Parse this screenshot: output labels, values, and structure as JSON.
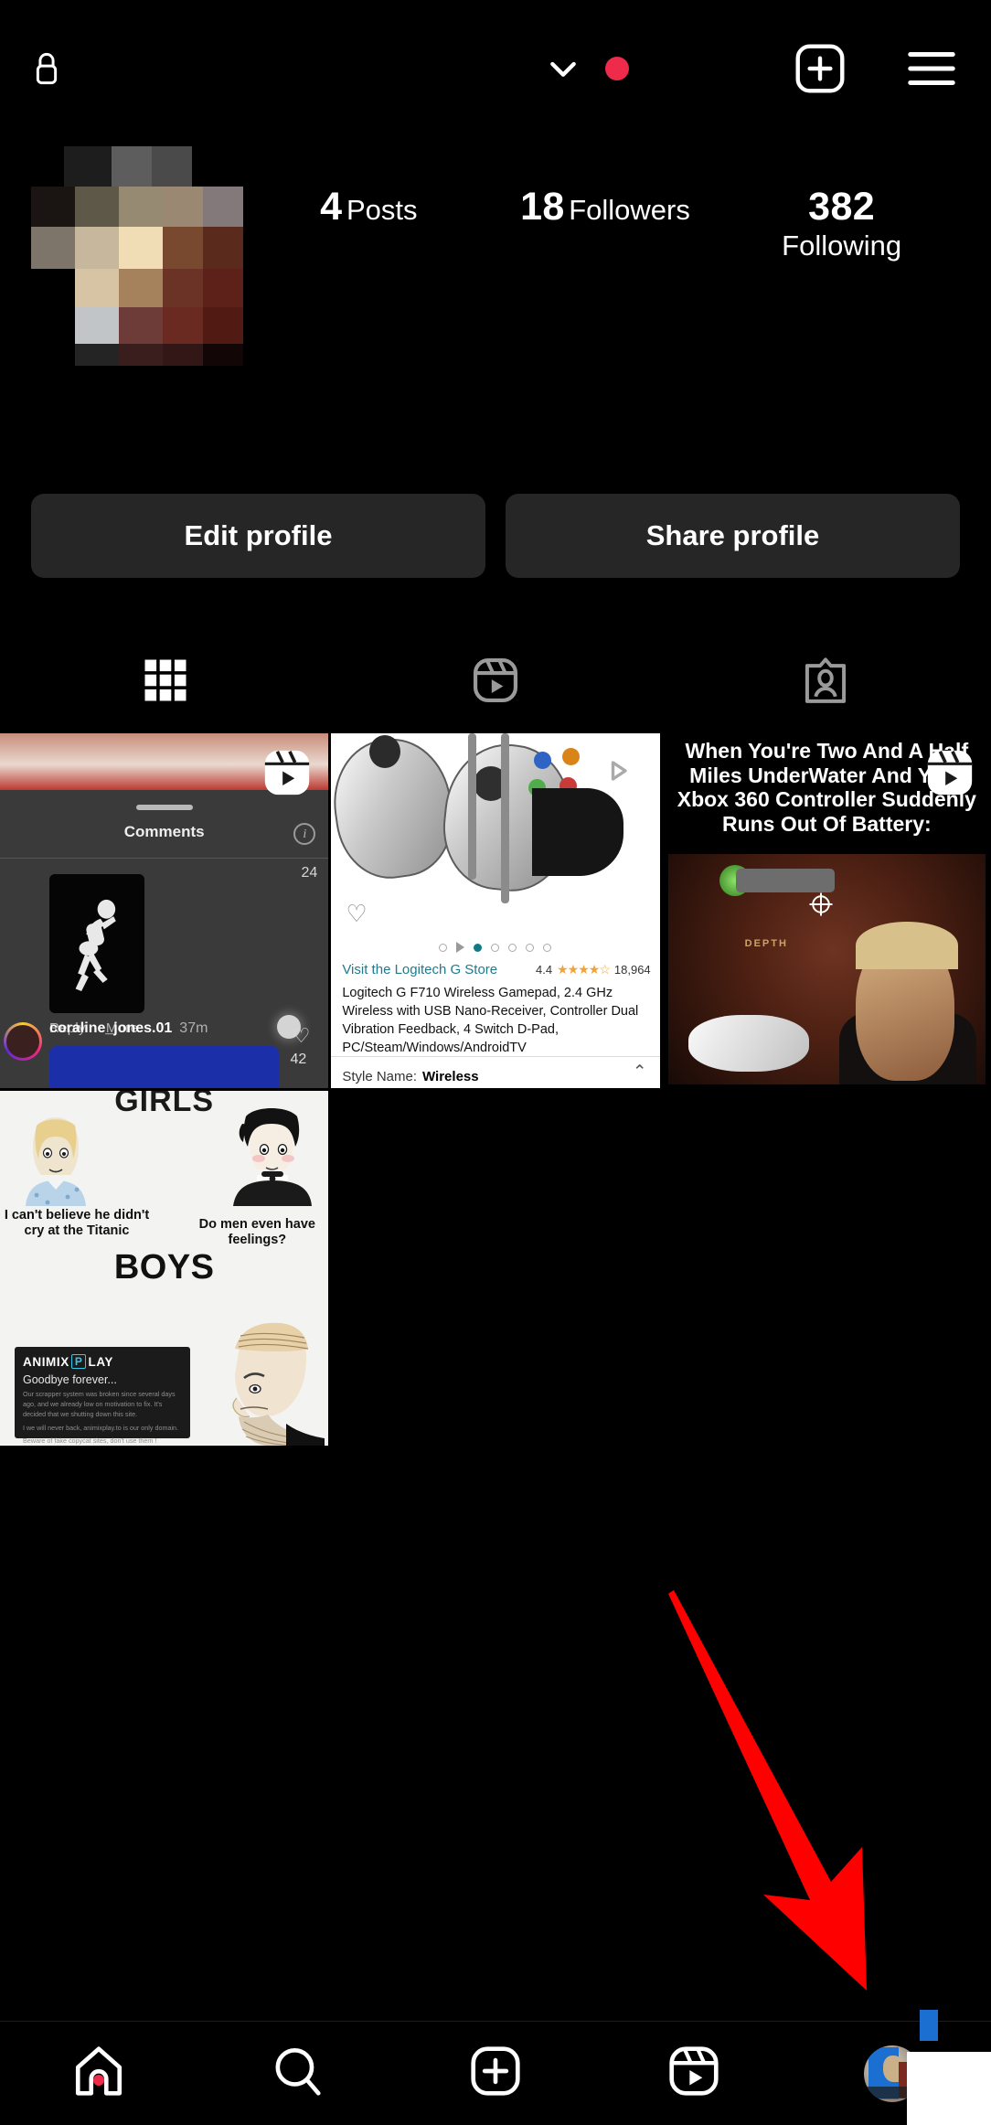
{
  "app": {
    "name": "Instagram",
    "theme": "dark",
    "accent_red": "#ef2b4b",
    "arrow_color": "#FF0000"
  },
  "topbar": {
    "lock_icon": "lock-icon",
    "username": "",
    "username_state": "redacted",
    "chevron_icon": "chevron-down-icon",
    "notification_dot": true,
    "new_post_icon": "plus-square-icon",
    "menu_icon": "hamburger-menu-icon"
  },
  "profile": {
    "avatar_state": "redacted",
    "display_name": "",
    "bio": "",
    "stats": [
      {
        "num": "4",
        "label": "Posts"
      },
      {
        "num": "18",
        "label": "Followers"
      },
      {
        "num": "382",
        "label": "Following"
      }
    ],
    "buttons": {
      "edit": "Edit profile",
      "share": "Share profile"
    }
  },
  "tabs": [
    {
      "name": "grid",
      "icon": "grid-icon",
      "active": true
    },
    {
      "name": "reels",
      "icon": "reels-icon",
      "active": false
    },
    {
      "name": "tagged",
      "icon": "tagged-icon",
      "active": false
    }
  ],
  "posts": [
    {
      "id": "post-1",
      "type": "reel",
      "kind": "comments-screen-recording",
      "sheet_title": "Comments",
      "info_icon": "info-icon",
      "reply_label": "Reply",
      "more_label": "More",
      "comment_count": "24",
      "commenter": "coraline_jones.01",
      "time_ago": "37m",
      "like_count": "42"
    },
    {
      "id": "post-2",
      "type": "image",
      "kind": "amazon-product-listing",
      "store_link": "Visit the Logitech G Store",
      "rating": "4.4",
      "stars": "★★★★☆",
      "review_count": "18,964",
      "title": "Logitech G F710 Wireless Gamepad, 2.4 GHz Wireless with USB Nano-Receiver, Controller Dual Vibration Feedback, 4 Switch D-Pad, PC/Steam/Windows/AndroidTV",
      "style_label": "Style Name:",
      "style_value": "Wireless",
      "caret_icon": "chevron-up-icon",
      "heart_icon": "heart-icon"
    },
    {
      "id": "post-3",
      "type": "reel",
      "kind": "meme-video",
      "caption": "When You're Two And A Half Miles UnderWater And Your Xbox 360 Controller Suddenly Runs Out Of Battery:",
      "overlay_word": "DEPTH"
    },
    {
      "id": "post-4",
      "type": "image",
      "kind": "wojak-meme",
      "header": "GIRLS",
      "left_caption": "I can't believe he didn't cry at the Titanic",
      "right_caption": "Do men even have feelings?",
      "mid_header": "BOYS",
      "notice_brand": "ANIMIX",
      "notice_brand_boxed": "P",
      "notice_brand_tail": "LAY",
      "notice_title": "Goodbye forever...",
      "notice_body": "Our scrapper system was broken since several days ago, and we already low on motivation to fix. It's decided that we shutting down this site.",
      "notice_body2": "I we will never back, animixplay.to is our only domain.",
      "notice_body3": "Beware of fake copycat sites, don't use them !"
    }
  ],
  "bottom_nav": [
    {
      "name": "home",
      "icon": "home-icon",
      "active": true,
      "badge_dot": true
    },
    {
      "name": "search",
      "icon": "search-icon",
      "active": false,
      "badge_dot": false
    },
    {
      "name": "create",
      "icon": "plus-square-icon",
      "active": false,
      "badge_dot": false
    },
    {
      "name": "reels",
      "icon": "reels-icon",
      "active": false,
      "badge_dot": false
    },
    {
      "name": "profile",
      "icon": "profile-avatar",
      "active": false,
      "badge_dot": false
    }
  ],
  "annotation": {
    "type": "arrow",
    "points_to": "profile-nav-tab"
  }
}
